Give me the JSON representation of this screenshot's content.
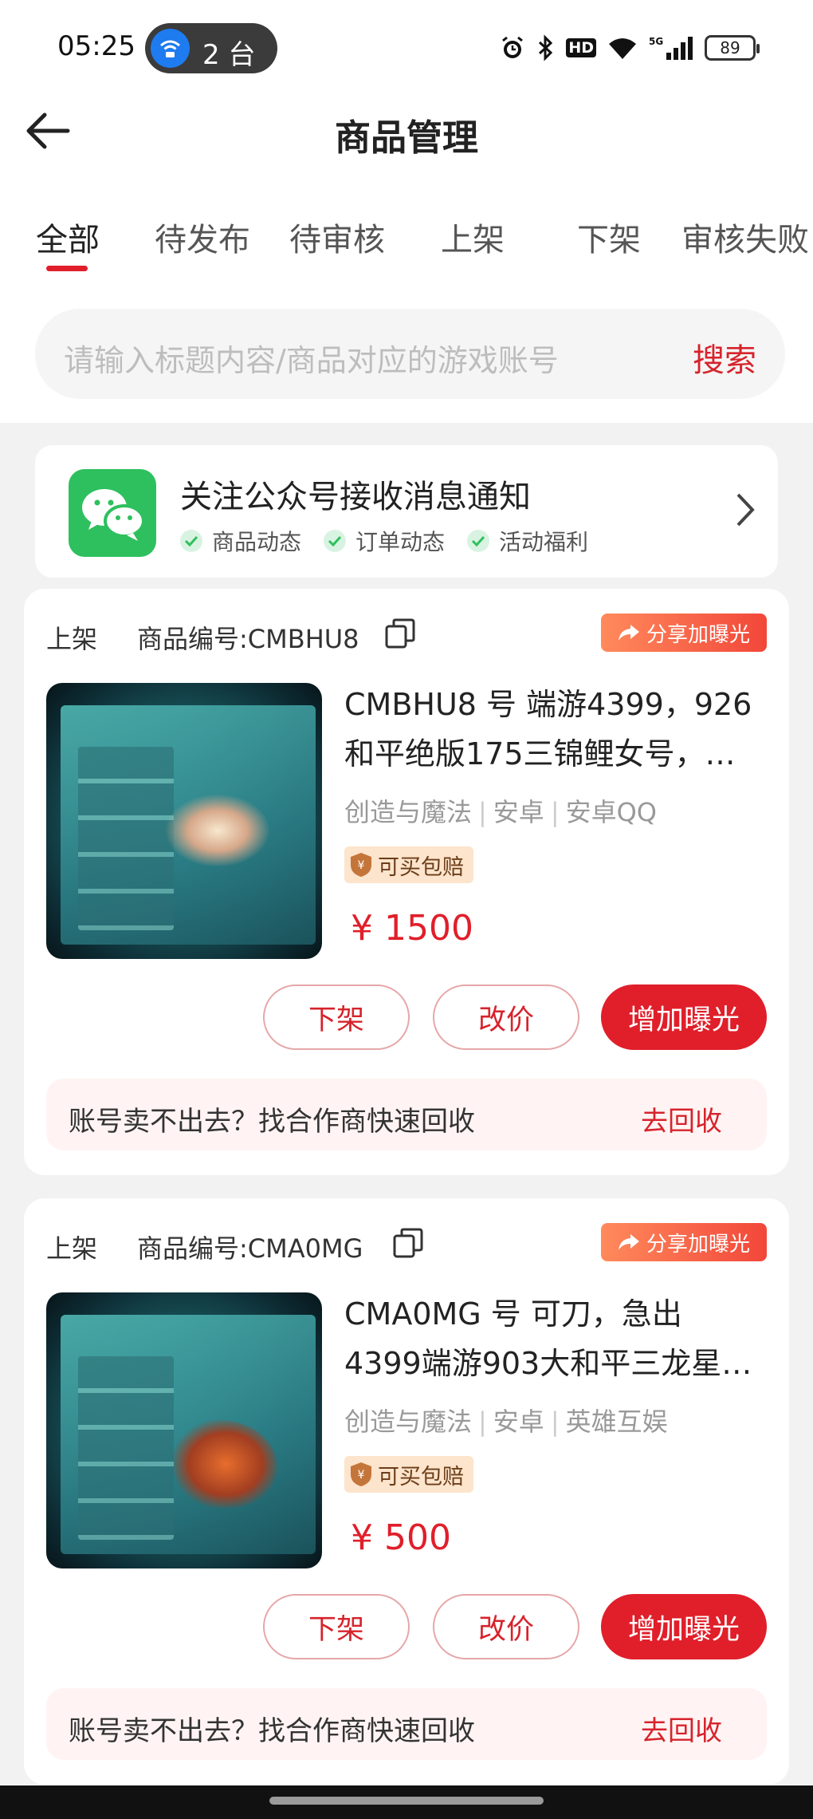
{
  "status_bar": {
    "time": "05:25",
    "hotspot_count": "2 台",
    "battery": "89",
    "network": "5G",
    "icons": [
      "alarm-icon",
      "bluetooth-icon",
      "hd-icon",
      "wifi-icon",
      "signal-icon",
      "battery-icon"
    ]
  },
  "header": {
    "title": "商品管理",
    "back_icon": "arrow-left-icon"
  },
  "tabs": [
    {
      "label": "全部",
      "active": true
    },
    {
      "label": "待发布",
      "active": false
    },
    {
      "label": "待审核",
      "active": false
    },
    {
      "label": "上架",
      "active": false
    },
    {
      "label": "下架",
      "active": false
    },
    {
      "label": "审核失败",
      "active": false
    }
  ],
  "search": {
    "placeholder": "请输入标题内容/商品对应的游戏账号",
    "button": "搜索"
  },
  "notice": {
    "title": "关注公众号接收消息通知",
    "chips": [
      "商品动态",
      "订单动态",
      "活动福利"
    ]
  },
  "products": [
    {
      "status": "上架",
      "code": "商品编号:CMBHU8",
      "share": "分享加曝光",
      "title_line1": "CMBHU8 号 端游4399，926",
      "title_line2": "和平绝版175三锦鲤女号，…",
      "tags": [
        "创造与魔法",
        "安卓",
        "安卓QQ"
      ],
      "guarantee": "可买包赔",
      "price": "¥ 1500",
      "buttons": {
        "off_shelf": "下架",
        "change_price": "改价",
        "boost": "增加曝光"
      },
      "recycle": {
        "text": "账号卖不出去？找合作商快速回收",
        "button": "去回收"
      }
    },
    {
      "status": "上架",
      "code": "商品编号:CMA0MG",
      "share": "分享加曝光",
      "title_line1": "CMA0MG 号 可刀，急出",
      "title_line2": "4399端游903大和平三龙星…",
      "tags": [
        "创造与魔法",
        "安卓",
        "英雄互娱"
      ],
      "guarantee": "可买包赔",
      "price": "¥ 500",
      "buttons": {
        "off_shelf": "下架",
        "change_price": "改价",
        "boost": "增加曝光"
      },
      "recycle": {
        "text": "账号卖不出去？找合作商快速回收",
        "button": "去回收"
      }
    }
  ],
  "colors": {
    "accent": "#e01f2a",
    "wechat": "#2ec05e",
    "guarantee_bg": "#fde4cc"
  }
}
